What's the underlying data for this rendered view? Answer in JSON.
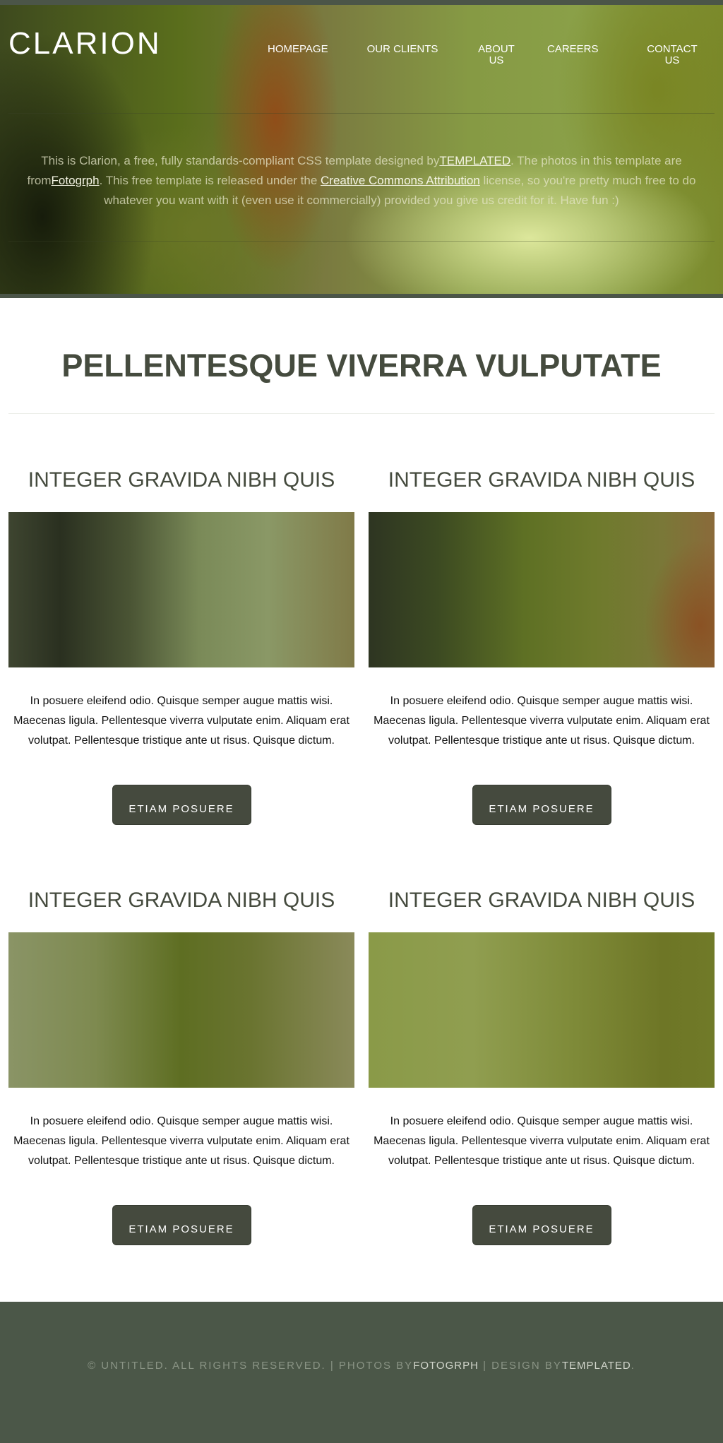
{
  "header": {
    "logo": "CLARION",
    "nav": [
      "HOMEPAGE",
      "OUR CLIENTS",
      "ABOUT US",
      "CAREERS",
      "CONTACT US"
    ],
    "intro": {
      "p1": "This is Clarion, a free, fully standards-compliant CSS template designed by",
      "link1": "TEMPLATED",
      "p2": ". The photos in this template are from",
      "link2": "Fotogrph",
      "p3": ". This free template is released under the ",
      "link3": "Creative Commons Attribution",
      "p4": " license, so you're pretty much free to do whatever you want with it (even use it commercially) provided you give us credit for it. Have fun :)"
    }
  },
  "main": {
    "title": "PELLENTESQUE VIVERRA VULPUTATE",
    "cards": [
      {
        "title": "INTEGER GRAVIDA NIBH QUIS",
        "text": "In posuere eleifend odio. Quisque semper augue mattis wisi. Maecenas ligula. Pellentesque viverra vulputate enim. Aliquam erat volutpat. Pellentesque tristique ante ut risus. Quisque dictum.",
        "button": "ETIAM POSUERE"
      },
      {
        "title": "INTEGER GRAVIDA NIBH QUIS",
        "text": "In posuere eleifend odio. Quisque semper augue mattis wisi. Maecenas ligula. Pellentesque viverra vulputate enim. Aliquam erat volutpat. Pellentesque tristique ante ut risus. Quisque dictum.",
        "button": "ETIAM POSUERE"
      },
      {
        "title": "INTEGER GRAVIDA NIBH QUIS",
        "text": "In posuere eleifend odio. Quisque semper augue mattis wisi. Maecenas ligula. Pellentesque viverra vulputate enim. Aliquam erat volutpat. Pellentesque tristique ante ut risus. Quisque dictum.",
        "button": "ETIAM POSUERE"
      },
      {
        "title": "INTEGER GRAVIDA NIBH QUIS",
        "text": "In posuere eleifend odio. Quisque semper augue mattis wisi. Maecenas ligula. Pellentesque viverra vulputate enim. Aliquam erat volutpat. Pellentesque tristique ante ut risus. Quisque dictum.",
        "button": "ETIAM POSUERE"
      }
    ]
  },
  "footer": {
    "t1": "© UNTITLED. ALL RIGHTS RESERVED. | PHOTOS BY",
    "link1": "FOTOGRPH",
    "t2": " | DESIGN BY",
    "link2": "TEMPLATED",
    "t3": "."
  }
}
